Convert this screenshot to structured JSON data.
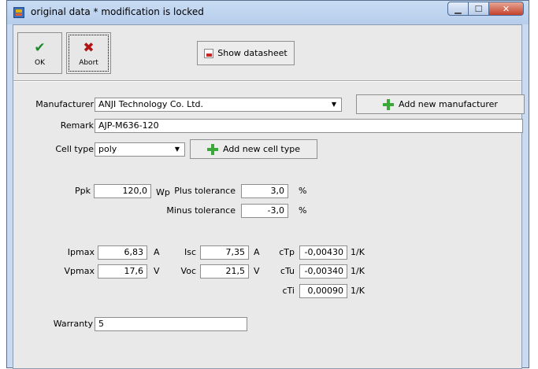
{
  "window": {
    "title": "original data * modification is locked",
    "controls": {
      "minimize": "▁",
      "maximize": "☐",
      "close": "✕"
    }
  },
  "toolbar": {
    "ok_label": "OK",
    "abort_label": "Abort",
    "datasheet_label": "Show datasheet"
  },
  "form": {
    "manufacturer_label": "Manufacturer",
    "manufacturer_value": "ANJI Technology Co. Ltd.",
    "add_manufacturer_label": "Add new manufacturer",
    "remark_label": "Remark",
    "remark_value": "AJP-M636-120",
    "celltype_label": "Cell type",
    "celltype_value": "poly",
    "add_celltype_label": "Add new cell type",
    "ppk_label": "Ppk",
    "ppk_value": "120,0",
    "ppk_unit": "Wp",
    "plus_tol_label": "Plus tolerance",
    "plus_tol_value": "3,0",
    "plus_tol_unit": "%",
    "minus_tol_label": "Minus tolerance",
    "minus_tol_value": "-3,0",
    "minus_tol_unit": "%",
    "ipmax_label": "Ipmax",
    "ipmax_value": "6,83",
    "ipmax_unit": "A",
    "vpmax_label": "Vpmax",
    "vpmax_value": "17,6",
    "vpmax_unit": "V",
    "isc_label": "Isc",
    "isc_value": "7,35",
    "isc_unit": "A",
    "voc_label": "Voc",
    "voc_value": "21,5",
    "voc_unit": "V",
    "ctp_label": "cTp",
    "ctp_value": "-0,00430",
    "ctp_unit": "1/K",
    "ctu_label": "cTu",
    "ctu_value": "-0,00340",
    "ctu_unit": "1/K",
    "cti_label": "cTi",
    "cti_value": "0,00090",
    "cti_unit": "1/K",
    "warranty_label": "Warranty",
    "warranty_value": "5"
  }
}
